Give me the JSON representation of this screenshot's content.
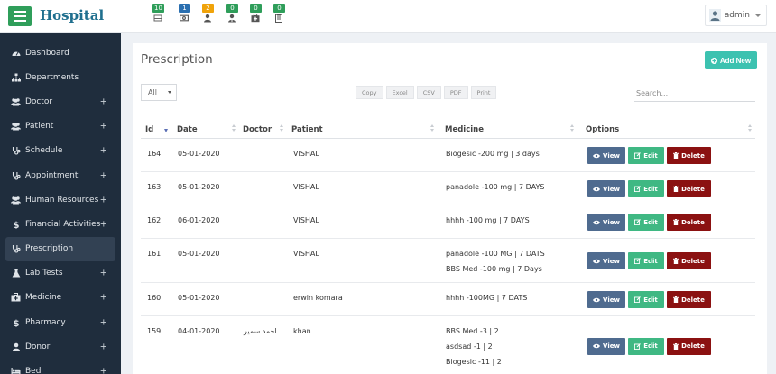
{
  "app": {
    "brand": "Hospital"
  },
  "notifications": [
    {
      "count": "10",
      "color": "#2f9e5a",
      "icon": "bed-icon"
    },
    {
      "count": "1",
      "color": "#2a6fb0",
      "icon": "money-icon"
    },
    {
      "count": "2",
      "color": "#f0a30a",
      "icon": "user-icon"
    },
    {
      "count": "0",
      "color": "#2f9e5a",
      "icon": "user-md-icon"
    },
    {
      "count": "0",
      "color": "#2f9e5a",
      "icon": "medkit-icon"
    },
    {
      "count": "0",
      "color": "#2f9e5a",
      "icon": "report-icon"
    }
  ],
  "user": {
    "name": "admin"
  },
  "sidebar": {
    "items": [
      {
        "label": "Dashboard",
        "icon": "dashboard-icon",
        "expandable": false
      },
      {
        "label": "Departments",
        "icon": "sitemap-icon",
        "expandable": false
      },
      {
        "label": "Doctor",
        "icon": "users-icon",
        "expandable": true
      },
      {
        "label": "Patient",
        "icon": "users-icon",
        "expandable": true
      },
      {
        "label": "Schedule",
        "icon": "stethoscope-icon",
        "expandable": true
      },
      {
        "label": "Appointment",
        "icon": "stethoscope-icon",
        "expandable": true
      },
      {
        "label": "Human Resources",
        "icon": "users-icon",
        "expandable": true
      },
      {
        "label": "Financial Activities",
        "icon": "dollar-icon",
        "expandable": true
      },
      {
        "label": "Prescription",
        "icon": "stethoscope-icon",
        "expandable": false,
        "active": true
      },
      {
        "label": "Lab Tests",
        "icon": "flask-icon",
        "expandable": true
      },
      {
        "label": "Medicine",
        "icon": "medkit-icon",
        "expandable": true
      },
      {
        "label": "Pharmacy",
        "icon": "dollar-icon",
        "expandable": true
      },
      {
        "label": "Donor",
        "icon": "user-icon",
        "expandable": true
      },
      {
        "label": "Bed",
        "icon": "bed-icon",
        "expandable": true
      }
    ]
  },
  "page": {
    "title": "Prescription",
    "add_label": "Add New",
    "length_select": "All",
    "export_buttons": [
      "Copy",
      "Excel",
      "CSV",
      "PDF",
      "Print"
    ],
    "search_placeholder": "Search..."
  },
  "table": {
    "columns": [
      "Id",
      "Date",
      "Doctor",
      "Patient",
      "Medicine",
      "Options"
    ],
    "buttons": {
      "view": "View",
      "edit": "Edit",
      "delete": "Delete"
    },
    "rows": [
      {
        "id": "164",
        "date": "05-01-2020",
        "doctor": "",
        "patient": "VISHAL",
        "medicine": [
          "Biogesic -200 mg | 3 days"
        ]
      },
      {
        "id": "163",
        "date": "05-01-2020",
        "doctor": "",
        "patient": "VISHAL",
        "medicine": [
          "panadole -100 mg | 7 DAYS"
        ]
      },
      {
        "id": "162",
        "date": "06-01-2020",
        "doctor": "",
        "patient": "VISHAL",
        "medicine": [
          "hhhh -100 mg | 7 DAYS"
        ]
      },
      {
        "id": "161",
        "date": "05-01-2020",
        "doctor": "",
        "patient": "VISHAL",
        "medicine": [
          "panadole -100 MG | 7 DATS",
          "BBS Med -100 mg | 7 Days"
        ]
      },
      {
        "id": "160",
        "date": "05-01-2020",
        "doctor": "",
        "patient": "erwin komara",
        "medicine": [
          "hhhh -100MG | 7 DATS"
        ]
      },
      {
        "id": "159",
        "date": "04-01-2020",
        "doctor": "احمد سمير",
        "patient": "khan",
        "medicine": [
          "BBS Med -3 | 2",
          "asdsad -1 | 2",
          "Biogesic -11 | 2"
        ]
      }
    ]
  }
}
